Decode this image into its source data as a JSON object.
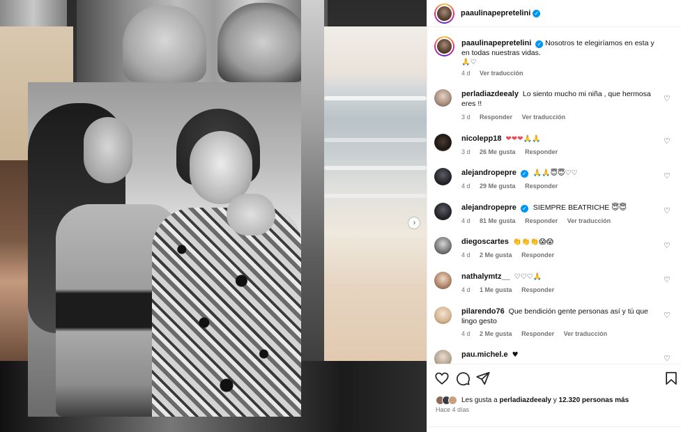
{
  "post": {
    "author": "paaulinapepretelini",
    "next_icon": "chevron-right-icon"
  },
  "caption": {
    "username": "paaulinapepretelini",
    "text": "Nosotros te elegiríamos en esta y en todas nuestras vidas.",
    "emojis": "🙏♡",
    "age": "4 d",
    "translate": "Ver traducción"
  },
  "comments": [
    {
      "username": "perladiazdeealy",
      "text": "Lo siento mucho mi niña , que hermosa eres !!",
      "verified": false,
      "age": "3 d",
      "likes": "",
      "reply": "Responder",
      "translate": "Ver traducción"
    },
    {
      "username": "nicolepp18",
      "text": "❤❤❤🙏🙏",
      "verified": false,
      "age": "3 d",
      "likes": "26 Me gusta",
      "reply": "Responder",
      "translate": ""
    },
    {
      "username": "alejandropepre",
      "text": "🙏🙏😇😇♡♡",
      "verified": true,
      "age": "4 d",
      "likes": "29 Me gusta",
      "reply": "Responder",
      "translate": ""
    },
    {
      "username": "alejandropepre",
      "text": "SIEMPRE BEATRICHE 😇😇",
      "verified": true,
      "age": "4 d",
      "likes": "81 Me gusta",
      "reply": "Responder",
      "translate": "Ver traducción"
    },
    {
      "username": "diegoscartes",
      "text": "👏👏👏😱😱",
      "verified": false,
      "age": "4 d",
      "likes": "2 Me gusta",
      "reply": "Responder",
      "translate": ""
    },
    {
      "username": "nathalymtz__",
      "text": "♡♡♡🙏",
      "verified": false,
      "age": "4 d",
      "likes": "1 Me gusta",
      "reply": "Responder",
      "translate": ""
    },
    {
      "username": "pilarendo76",
      "text": "Que bendición gente personas así y tú que lingo gesto",
      "verified": false,
      "age": "4 d",
      "likes": "2 Me gusta",
      "reply": "Responder",
      "translate": "Ver traducción"
    },
    {
      "username": "pau.michel.e",
      "text": "♥",
      "verified": false,
      "age": "",
      "likes": "",
      "reply": "",
      "translate": ""
    }
  ],
  "actions": {
    "like_icon": "heart-icon",
    "comment_icon": "comment-icon",
    "share_icon": "send-icon",
    "save_icon": "bookmark-icon",
    "likes_prefix": "Les gusta a",
    "likes_user": "perladiazdeealy",
    "likes_middle": "y",
    "likes_count": "12.320 personas más",
    "time": "Hace 4 días"
  },
  "colors": {
    "verified": "#0095f6",
    "muted": "#737373",
    "heart_red": "#ed4956"
  }
}
